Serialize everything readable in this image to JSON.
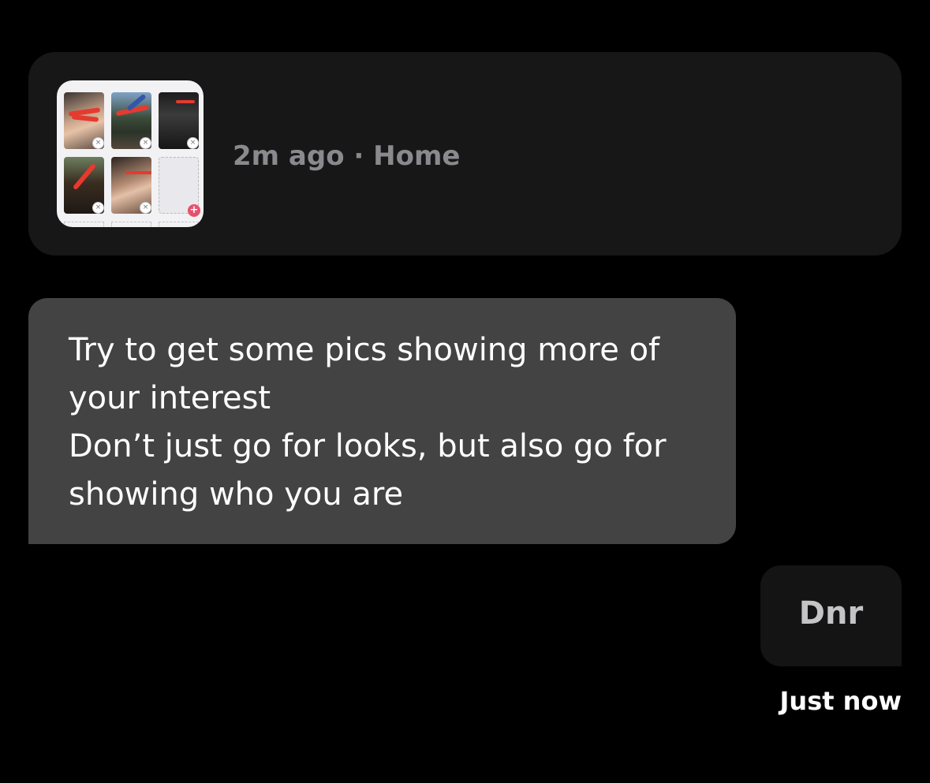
{
  "shared_card": {
    "meta_time": "2m ago",
    "meta_separator": " · ",
    "meta_context": "Home",
    "thumbnail_icons": {
      "remove": "×",
      "add": "+"
    }
  },
  "messages": {
    "incoming": {
      "lines": [
        "Try to get some pics showing more of",
        "your interest",
        "Don’t just go for looks, but also go for",
        "showing who you are"
      ]
    },
    "outgoing": {
      "text": "Dnr",
      "timestamp": "Just now"
    }
  },
  "colors": {
    "background": "#000000",
    "card": "#171717",
    "incoming_bubble": "#434343",
    "outgoing_bubble": "#141414",
    "meta_text": "#8a8a8e",
    "scribble": "#e63a2e",
    "add_accent": "#e8506a"
  }
}
